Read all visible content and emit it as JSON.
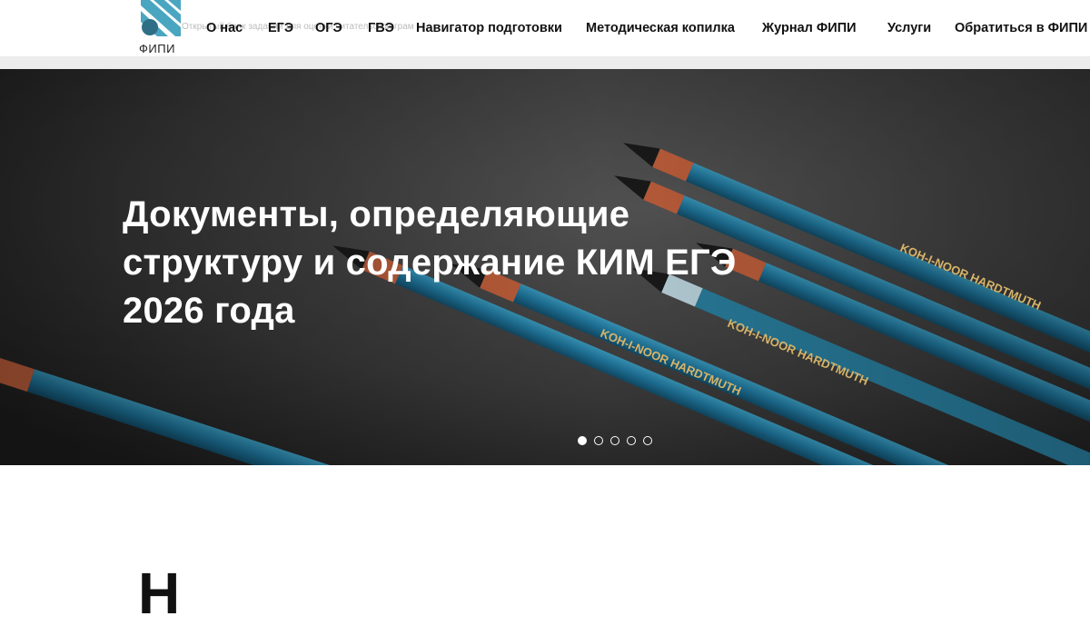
{
  "header": {
    "logo_text": "ФИПИ",
    "ghost_text": "Открытый банк заданий для оценки читательской грамотности",
    "nav": [
      {
        "label": "О нас"
      },
      {
        "label": "ЕГЭ"
      },
      {
        "label": "ОГЭ"
      },
      {
        "label": "ГВЭ"
      },
      {
        "label": "Навигатор подготовки"
      },
      {
        "label": "Методическая копилка"
      },
      {
        "label": "Журнал ФИПИ"
      },
      {
        "label": "Услуги"
      },
      {
        "label": "Обратиться в ФИПИ"
      }
    ]
  },
  "hero": {
    "title": "Документы, определяющие структуру и содержание КИМ ЕГЭ 2026 года",
    "pencil_text": [
      "KOH-I-NOOR HARDTMUTH",
      "KOH-I-NOOR HARDTMUTH",
      "KOH-I-NOOR HARDTMUTH"
    ],
    "slides": 5,
    "active_slide": 1
  },
  "section": {
    "heading_fragment": "Н"
  },
  "colors": {
    "accent": "#3bb3c4",
    "logo_blue": "#5aa7bd",
    "pencil_blue": "#1e7fa6",
    "pencil_tip": "#c9643f"
  }
}
